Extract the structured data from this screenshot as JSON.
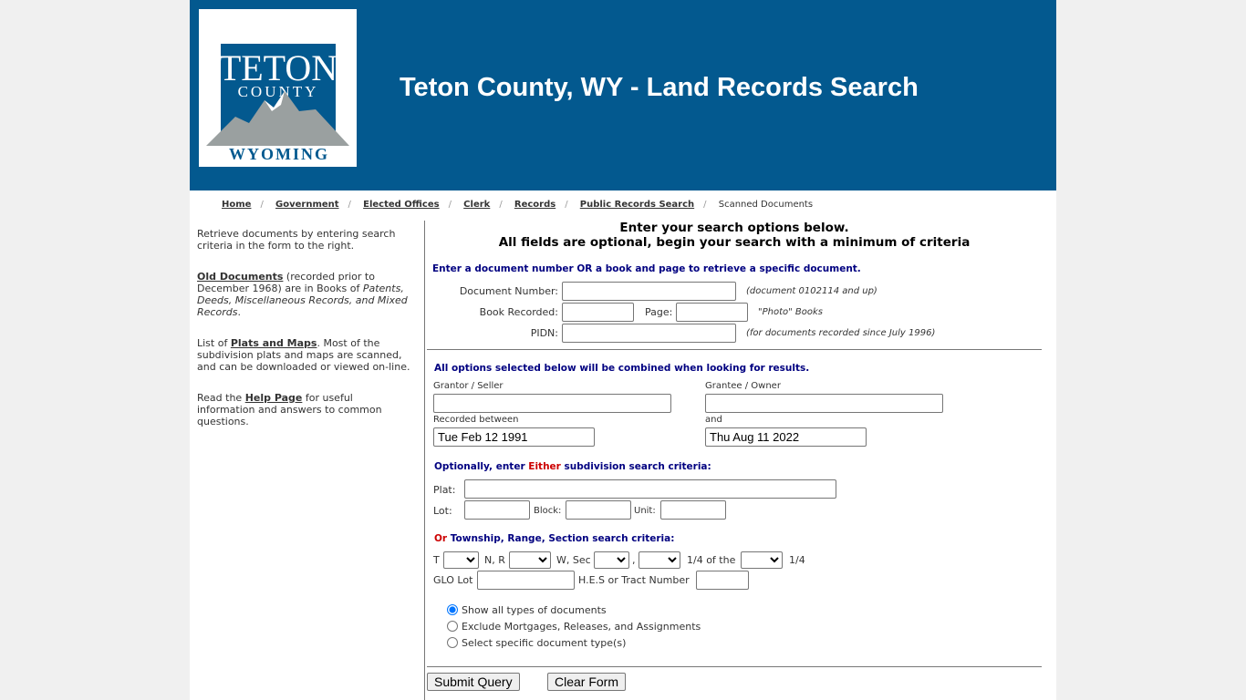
{
  "header": {
    "title": "Teton County, WY - Land Records Search",
    "logo_text": [
      "TETON",
      "COUNTY",
      "WYOMING"
    ],
    "brand_color": "#03598f"
  },
  "breadcrumb": {
    "items": [
      "Home",
      "Government",
      "Elected Offices",
      "Clerk",
      "Records",
      "Public Records Search"
    ],
    "current": "Scanned Documents"
  },
  "sidebar": {
    "p1": "Retrieve documents by entering search criteria in the form to the right.",
    "p2_link": "Old Documents",
    "p2_a": " (recorded prior to December 1968) are in Books of ",
    "p2_i": "Patents, Deeds, Miscellaneous Records, and Mixed Records",
    "p3_a": "List of ",
    "p3_link": "Plats and Maps",
    "p3_b": ". Most of the subdivision plats and maps are scanned, and can be downloaded or viewed on-line.",
    "p4_a": "Read the ",
    "p4_link": "Help Page",
    "p4_b": " for useful information and answers to common questions."
  },
  "form": {
    "heading1": "Enter your search options below.",
    "heading2": "All fields are optional, begin your search with a minimum of criteria",
    "specific_label": "Enter a document number OR a book and page to retrieve a specific document.",
    "doc_number_label": "Document Number:",
    "doc_number_note": "(document 0102114 and up)",
    "book_label": "Book Recorded:",
    "page_label": "Page:",
    "book_note": "\"Photo\" Books",
    "pidn_label": "PIDN:",
    "pidn_note": "(for documents recorded since July 1996)",
    "combined_label": "All options selected below will be combined when looking for results.",
    "grantor_label": "Grantor / Seller",
    "grantee_label": "Grantee / Owner",
    "recorded_label": "Recorded between",
    "and_label": "and",
    "date_from": "Tue Feb 12 1991",
    "date_to": "Thu Aug 11 2022",
    "subdiv_a": "Optionally, enter ",
    "subdiv_red": "Either",
    "subdiv_b": " subdivision search criteria:",
    "plat_label": "Plat:",
    "lot_label": "Lot:",
    "block_label": "Block:",
    "unit_label": "Unit:",
    "trs_red": "Or",
    "trs_b": " Township, Range, Section search criteria:",
    "t_label": "T",
    "nr_label": "N, R",
    "wsec_label": "W, Sec",
    "comma": ",",
    "quarter_of": "1/4 of the",
    "quarter": "1/4",
    "glo_label": "GLO Lot",
    "hes_label": "H.E.S or Tract Number",
    "radios": [
      "Show all types of documents",
      "Exclude Mortgages, Releases, and Assignments",
      "Select specific document type(s)"
    ],
    "radio_selected": 0,
    "submit": "Submit Query",
    "clear": "Clear Form"
  }
}
